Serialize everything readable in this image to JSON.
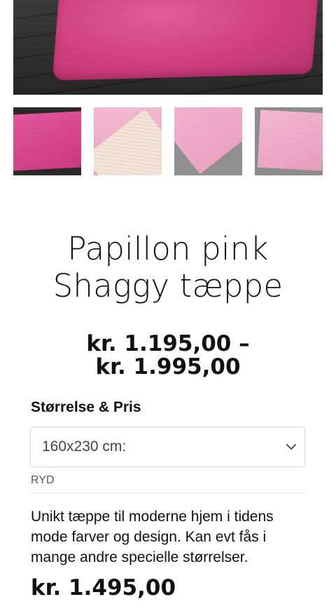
{
  "product": {
    "title_line1": "Papillon pink",
    "title_line2": "Shaggy tæppe",
    "price_min": "kr. 1.195,00 –",
    "price_max": "kr. 1.995,00"
  },
  "gallery": {
    "main_image": "pink-shaggy-rug-photo",
    "thumbnails": [
      "rug-on-floor",
      "rug-back-corner",
      "rug-corner-closeup",
      "rug-on-grey"
    ]
  },
  "variation": {
    "label": "Størrelse & Pris",
    "selected": "160x230 cm:",
    "reset_label": "RYD",
    "description": "Unikt tæppe til moderne hjem i tidens mode farver og design. Kan evt fås i mange andre specielle størrelser.",
    "price": "kr. 1.495,00"
  },
  "colors": {
    "rug_pink": "#cf3f80",
    "text": "#111111",
    "border": "#dcdcdc"
  }
}
